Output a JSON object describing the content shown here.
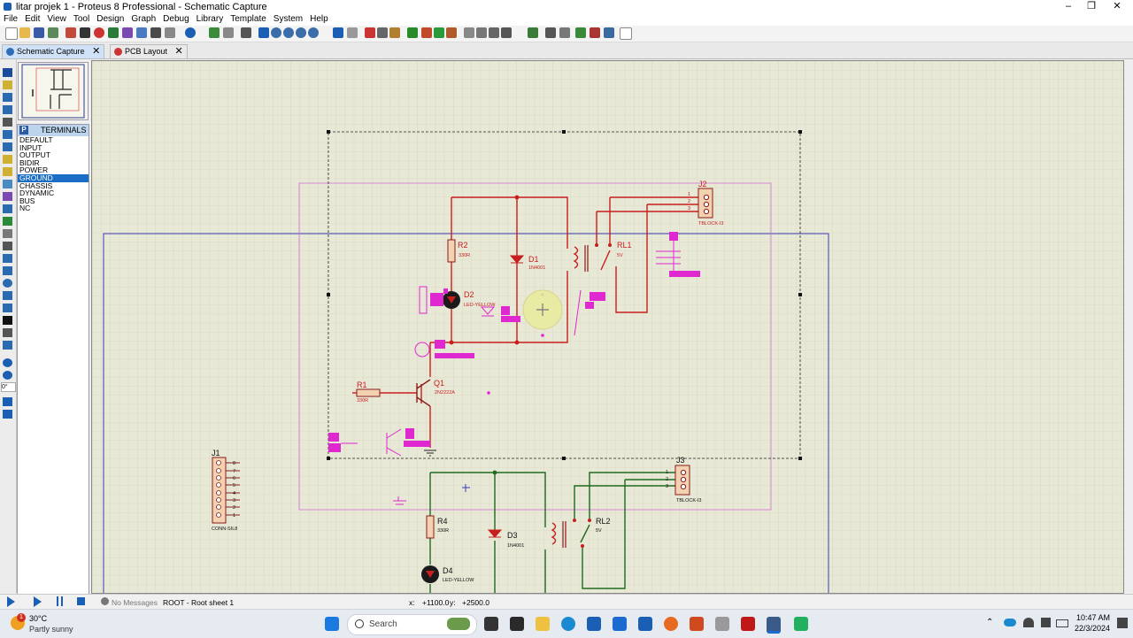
{
  "window": {
    "title": "litar projek 1 - Proteus 8 Professional - Schematic Capture",
    "controls": [
      "–",
      "❐",
      "✕"
    ]
  },
  "menu": [
    "File",
    "Edit",
    "View",
    "Tool",
    "Design",
    "Graph",
    "Debug",
    "Library",
    "Template",
    "System",
    "Help"
  ],
  "tabs": [
    {
      "label": "Schematic Capture",
      "close": "✕",
      "active": true
    },
    {
      "label": "PCB Layout",
      "close": "✕",
      "active": false
    }
  ],
  "terminals": {
    "header": "TERMINALS",
    "badge": "P",
    "items": [
      "DEFAULT",
      "INPUT",
      "OUTPUT",
      "BIDIR",
      "POWER",
      "GROUND",
      "CHASSIS",
      "DYNAMIC",
      "BUS",
      "NC"
    ],
    "selected": "GROUND"
  },
  "left_rotation_readout": "0°",
  "schematic": {
    "components": {
      "J2": {
        "ref": "J2",
        "value": "TBLOCK-I3",
        "pins": [
          "1",
          "2",
          "3"
        ]
      },
      "RL1": {
        "ref": "RL1",
        "value": "5V"
      },
      "R2": {
        "ref": "R2",
        "value": "330R"
      },
      "D1": {
        "ref": "D1",
        "value": "1N4001"
      },
      "D2": {
        "ref": "D2",
        "value": "LED-YELLOW"
      },
      "Q1": {
        "ref": "Q1",
        "value": "2N2222A"
      },
      "R1": {
        "ref": "R1",
        "value": "330R"
      },
      "J1": {
        "ref": "J1",
        "value": "CONN-SIL8",
        "pins": [
          "8",
          "7",
          "6",
          "5",
          "4",
          "3",
          "2",
          "1"
        ]
      },
      "J3": {
        "ref": "J3",
        "value": "TBLOCK-I3",
        "pins": [
          "1",
          "2",
          "3"
        ]
      },
      "RL2": {
        "ref": "RL2",
        "value": "5V"
      },
      "R4": {
        "ref": "R4",
        "value": "330R"
      },
      "D3": {
        "ref": "D3",
        "value": "1N4001"
      },
      "D4": {
        "ref": "D4",
        "value": "LED-YELLOW"
      }
    }
  },
  "status": {
    "messages": "No Messages",
    "sheet": "ROOT - Root sheet 1",
    "x_label": "x:",
    "x_value": "+1100.0",
    "y_label": "y:",
    "y_value": "+2500.0"
  },
  "taskbar": {
    "weather_temp": "30°C",
    "weather_desc": "Partly sunny",
    "weather_badge": "1",
    "search_placeholder": "Search",
    "time": "10:47 AM",
    "date": "22/3/2024"
  }
}
